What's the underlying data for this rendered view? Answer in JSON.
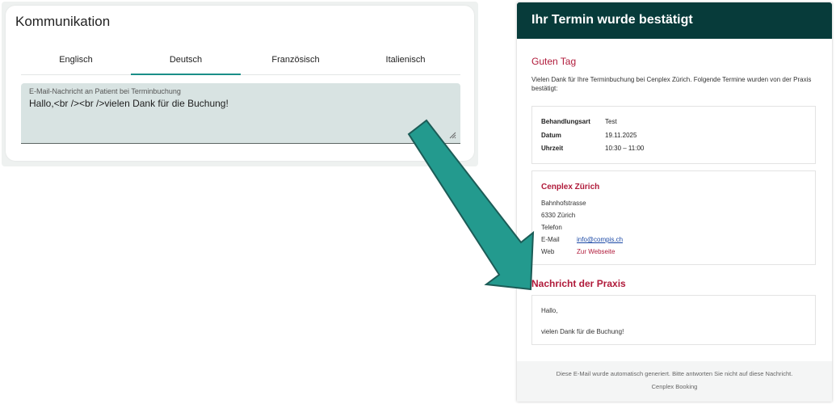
{
  "settings": {
    "title": "Kommunikation",
    "tabs": [
      {
        "label": "Englisch",
        "active": false
      },
      {
        "label": "Deutsch",
        "active": true
      },
      {
        "label": "Französisch",
        "active": false
      },
      {
        "label": "Italienisch",
        "active": false
      }
    ],
    "field": {
      "label": "E-Mail-Nachricht an Patient bei Terminbuchung",
      "value": "Hallo,<br /><br />vielen Dank für die Buchung!"
    }
  },
  "email": {
    "header_title": "Ihr Termin wurde bestätigt",
    "greeting": "Guten Tag",
    "intro": "Vielen Dank für Ihre Terminbuchung bei Cenplex Zürich. Folgende Termine wurden von der Praxis bestätigt:",
    "details": [
      {
        "label": "Behandlungsart",
        "value": "Test"
      },
      {
        "label": "Datum",
        "value": "19.11.2025"
      },
      {
        "label": "Uhrzeit",
        "value": "10:30 – 11:00"
      }
    ],
    "practice": {
      "name": "Cenplex Zürich",
      "street": "Bahnhofstrasse",
      "city": "6330 Zürich",
      "phone_label": "Telefon",
      "email_label": "E-Mail",
      "email_value": "info@compis.ch",
      "web_label": "Web",
      "web_value": "Zur Webseite"
    },
    "message_title": "Nachricht der Praxis",
    "message_lines": [
      "Hallo,",
      "vielen Dank für die Buchung!"
    ],
    "footer_note": "Diese E-Mail wurde automatisch generiert. Bitte antworten Sie nicht auf diese Nachricht.",
    "footer_brand": "Cenplex Booking"
  },
  "colors": {
    "accent": "#1a8e88",
    "arrow": "#239a8e",
    "header_bg": "#073b3a",
    "heading_red": "#b01a3a",
    "field_bg": "#d8e3e2"
  }
}
